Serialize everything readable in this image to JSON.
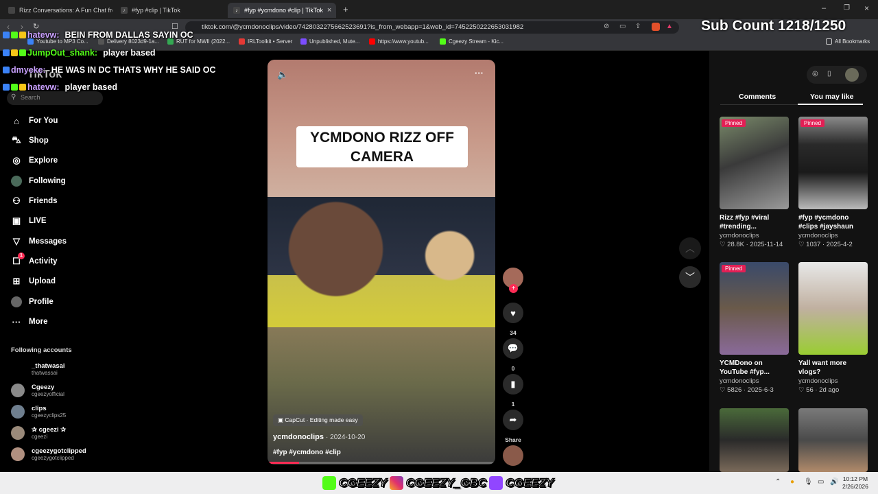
{
  "browser": {
    "tabs": [
      {
        "label": "Rizz Conversations: A Fun Chat from",
        "active": false
      },
      {
        "label": "#fyp #clip | TikTok",
        "active": false
      },
      {
        "label": "#fyp #ycmdono #clip | TikTok",
        "active": true
      }
    ],
    "url": "tiktok.com/@ycmdonoclips/video/7428032275662523691?is_from_webapp=1&web_id=7452250222653031982",
    "bookmarks": [
      "Youtube to MP3 Co...",
      "Delivery 8023d9-1a...",
      "RUT for MWII (2022...",
      "IRLToolkit • Server",
      "Unpublished, Mute...",
      "https://www.youtub...",
      "Cgeezy Stream - Kic..."
    ],
    "all_bookmarks": "All Bookmarks"
  },
  "tiktok": {
    "logo": "TikTok",
    "search_placeholder": "Search",
    "nav": [
      {
        "label": "For You",
        "icon": "home-icon"
      },
      {
        "label": "Shop",
        "icon": "shop-bag-icon"
      },
      {
        "label": "Explore",
        "icon": "compass-icon"
      },
      {
        "label": "Following",
        "icon": "avatar-icon"
      },
      {
        "label": "Friends",
        "icon": "friends-icon"
      },
      {
        "label": "LIVE",
        "icon": "live-icon"
      },
      {
        "label": "Messages",
        "icon": "send-icon"
      },
      {
        "label": "Activity",
        "icon": "activity-icon",
        "badge": "1"
      },
      {
        "label": "Upload",
        "icon": "plus-square-icon"
      },
      {
        "label": "Profile",
        "icon": "profile-icon"
      },
      {
        "label": "More",
        "icon": "more-dots-icon"
      }
    ],
    "following_header": "Following accounts",
    "following": [
      {
        "name": "_thatwasai",
        "handle": "thatwassai"
      },
      {
        "name": "Cgeezy",
        "handle": "cgeezyofficial"
      },
      {
        "name": "clips",
        "handle": "cgeezyclips25"
      },
      {
        "name": "✰ cgeezi ✰",
        "handle": "cgeezi"
      },
      {
        "name": "cgeezygotclipped",
        "handle": "cgeezygotclipped"
      }
    ]
  },
  "video": {
    "title_card": "YCMDONO RIZZ OFF CAMERA",
    "capcut": "CapCut · Editing made easy",
    "author": "ycmdonoclips",
    "date": "· 2024-10-20",
    "hashtags": "#fyp #ycmdono #clip",
    "likes": "34",
    "comments": "0",
    "saves": "1",
    "share": "Share",
    "progress": 0.14
  },
  "right_panel": {
    "tabs": [
      "Comments",
      "You may like"
    ],
    "cards": [
      {
        "pinned": "Pinned",
        "caption": "Rizz #fyp #viral #trending...",
        "author": "ycmdonoclips",
        "meta": "♡ 28.8K · 2025-11-14"
      },
      {
        "pinned": "Pinned",
        "caption": "#fyp #ycmdono #clips #jayshaun",
        "author": "ycmdonoclips",
        "meta": "♡ 1037 · 2025-4-2"
      },
      {
        "pinned": "Pinned",
        "caption": "YCMDono on YouTube #fyp...",
        "author": "ycmdonoclips",
        "meta": "♡ 5826 · 2025-6-3"
      },
      {
        "pinned": "",
        "caption": "Yall want more vlogs?",
        "author": "ycmdonoclips",
        "meta": "♡ 56 · 2d ago"
      },
      {
        "pinned": "",
        "caption": "",
        "author": "",
        "meta": ""
      },
      {
        "pinned": "",
        "caption": "",
        "author": "",
        "meta": ""
      }
    ]
  },
  "overlay": {
    "sub_count": "Sub Count 1218/1250",
    "chat": [
      {
        "user": "hatevw:",
        "msg": "BEIN FROM DALLAS SAYIN OC"
      },
      {
        "user": "JumpOut_shank:",
        "msg": "player based"
      },
      {
        "user": "dmyeke:",
        "msg": "HE WAS IN DC THATS WHY HE SAID OC"
      },
      {
        "user": "hatevw:",
        "msg": "player based"
      }
    ],
    "banner": [
      "CGEEZY",
      "CGEEZY_GBC",
      "CGEEZY"
    ]
  },
  "taskbar": {
    "time": "10:12 PM",
    "date": "2/26/2026"
  }
}
